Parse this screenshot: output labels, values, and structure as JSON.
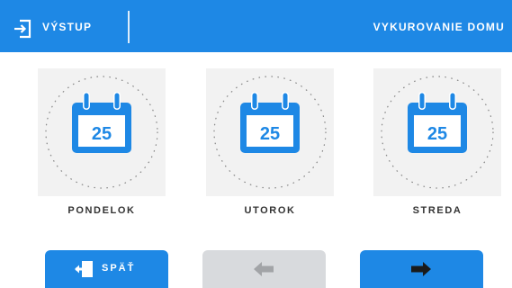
{
  "header": {
    "exit_label": "VÝSTUP",
    "title": "VYKUROVANIE DOMU",
    "exit_icon": "exit-icon"
  },
  "days": [
    {
      "label": "PONDELOK",
      "calendar_day": "25",
      "icon": "calendar-icon"
    },
    {
      "label": "UTOROK",
      "calendar_day": "25",
      "icon": "calendar-icon"
    },
    {
      "label": "STREDA",
      "calendar_day": "25",
      "icon": "calendar-icon"
    }
  ],
  "footer": {
    "back_label": "SPÄŤ",
    "back_icon": "door-exit-icon",
    "prev_icon": "arrow-left-icon",
    "next_icon": "arrow-right-icon"
  },
  "colors": {
    "accent": "#1e88e5",
    "disabled": "#d8dadd",
    "tile_background": "#f2f2f2",
    "text": "#333333"
  }
}
